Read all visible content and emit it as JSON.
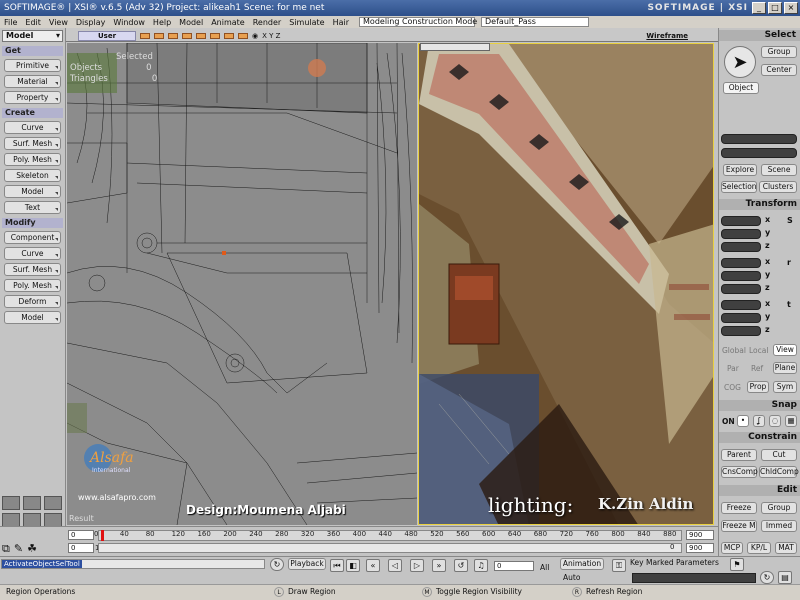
{
  "window": {
    "title": "SOFTIMAGE® | XSI® v.6.5 (Adv 32) Project: alikeah1   Scene: for me net",
    "brand": "SOFTIMAGE | XSI",
    "controls": [
      "_",
      "□",
      "×"
    ]
  },
  "menu": {
    "items": [
      "File",
      "Edit",
      "View",
      "Display",
      "Window",
      "Help",
      "Model",
      "Animate",
      "Render",
      "Simulate",
      "Hair"
    ],
    "construction_mode": "Modeling Construction Mode",
    "pass": "Default_Pass"
  },
  "left": {
    "mode": "Model",
    "sections": [
      {
        "title": "Get",
        "buttons": [
          "Primitive",
          "Material",
          "Property"
        ]
      },
      {
        "title": "Create",
        "buttons": [
          "Curve",
          "Surf. Mesh",
          "Poly. Mesh",
          "Skeleton",
          "Model",
          "Text"
        ]
      },
      {
        "title": "Modify",
        "buttons": [
          "Component",
          "Curve",
          "Surf. Mesh",
          "Poly. Mesh",
          "Deform",
          "Model"
        ]
      }
    ]
  },
  "viewport1": {
    "camera": "User",
    "axes": "X Y Z",
    "hud": {
      "selected": "Selected",
      "objects_label": "Objects",
      "objects_value": "0",
      "triangles_label": "Triangles",
      "triangles_value": "0"
    },
    "result_label": "Result"
  },
  "viewport2": {
    "mode": "Wireframe"
  },
  "overlay": {
    "logo_name": "Alsafa",
    "logo_sub": "International",
    "logo_url": "www.alsafapro.com",
    "design_credit": "Design:Moumena Aljabi",
    "lighting_label": "lighting:",
    "lighting_credit": "K.Zin Aldin"
  },
  "right": {
    "select_header": "Select",
    "group": "Group",
    "center": "Center",
    "object": "Object",
    "explore": "Explore",
    "scene": "Scene",
    "selection": "Selection",
    "clusters": "Clusters",
    "transform_header": "Transform",
    "axes": [
      "x",
      "y",
      "z"
    ],
    "s_label": "S",
    "r_label": "r",
    "t_label": "t",
    "global": "Global",
    "local": "Local",
    "view": "View",
    "par": "Par",
    "ref": "Ref",
    "plane": "Plane",
    "cog": "COG",
    "prop": "Prop",
    "sym": "Sym",
    "snap_header": "Snap",
    "on": "ON",
    "constrain_header": "Constrain",
    "parent": "Parent",
    "cut": "Cut",
    "cnscomp": "CnsComp",
    "childcomp": "ChldComp",
    "edit_header": "Edit",
    "freeze": "Freeze",
    "edit_group": "Group",
    "freeze_m": "Freeze M",
    "immed": "Immed",
    "mcp": "MCP",
    "kpl": "KP/L",
    "mat": "MAT"
  },
  "timeline": {
    "ticks": [
      "0",
      "40",
      "80",
      "120",
      "160",
      "200",
      "240",
      "280",
      "320",
      "360",
      "400",
      "440",
      "480",
      "520",
      "560",
      "600",
      "640",
      "680",
      "720",
      "760",
      "800",
      "840",
      "880"
    ],
    "start": "0",
    "start2": "0",
    "current": "0",
    "end": "900",
    "end2": "900",
    "mark_1": "1"
  },
  "playback": {
    "command": "ActivateObjectSelTool",
    "playback_label": "Playback",
    "frame": "0",
    "all": "All",
    "animation_label": "Animation",
    "auto": "Auto",
    "key_marked": "Key Marked Parameters"
  },
  "status": {
    "region_operations": "Region Operations",
    "l": "L",
    "draw_region": "Draw Region",
    "m": "M",
    "toggle_visibility": "Toggle Region Visibility",
    "r": "R",
    "refresh_region": "Refresh Region"
  }
}
